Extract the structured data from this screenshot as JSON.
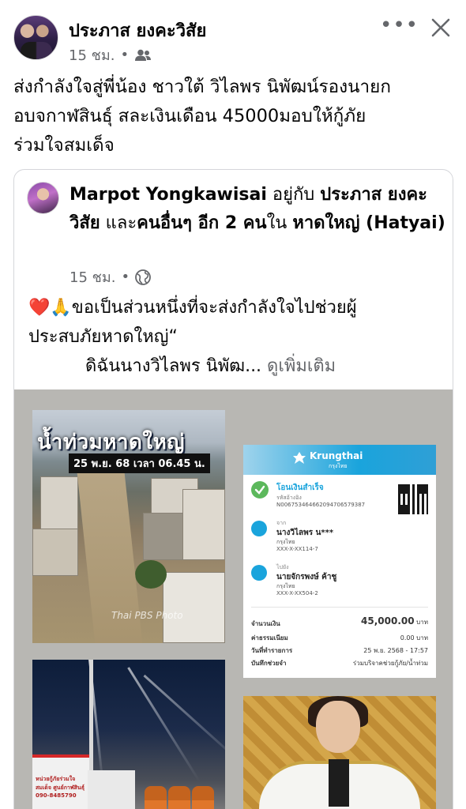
{
  "header": {
    "author": "ประภาส ยงคะวิสัย",
    "time": "15 ชม.",
    "separator": "•",
    "audience_icon": "friends-icon",
    "more_label": "•••",
    "close_icon": "close-icon"
  },
  "post": {
    "text_line1": "ส่งกำลังใจสู่พี่น้อง ชาวใต้ วิไลพร นิพัฒน์รองนายก",
    "text_line2": "อบจกาฬสินธุ์ สละเงินเดือน 45000มอบให้กู้ภัย",
    "text_line3": "ร่วมใจสมเด็จ"
  },
  "shared": {
    "author": "Marpot Yongkawisai",
    "with_word": " อยู่กับ ",
    "tagged": "ประภาส ยงคะวิสัย",
    "and_others_prefix": " และ",
    "others": "คนอื่นๆ อีก 2 คน",
    "in_word": "ใน ",
    "place": "หาดใหญ่ (Hatyai)",
    "time": "15 ชม.",
    "separator": "•",
    "audience_icon": "globe-icon",
    "body_line1_emoji": "❤️🙏",
    "body_line1": "ขอเป็นส่วนหนึ่งที่จะส่งกำลังใจไปช่วยผู้",
    "body_line2": "ประสบภัยหาดใหญ่“",
    "body_line3": "ดิฉันนางวิไลพร  นิพัฒ... ",
    "see_more": "ดูเพิ่มเติม"
  },
  "media": {
    "flood": {
      "title": "น้ำท่วมหาดใหญ่",
      "date": "25 พ.ย. 68 เวลา 06.45 น.",
      "watermark": "Thai PBS Photo"
    },
    "slip": {
      "bank": "Krungthai",
      "bank_th": "กรุงไทย",
      "status": "โอนเงินสำเร็จ",
      "ref_label": "รหัสอ้างอิง",
      "ref": "N006753464662094706579387",
      "from_label": "จาก",
      "from_name": "นางวิไลพร น***",
      "from_bank": "กรุงไทย",
      "from_acct": "XXX-X-XX114-7",
      "to_label": "ไปยัง",
      "to_name": "นายจักรพงษ์ ค้าชู",
      "to_bank": "กรุงไทย",
      "to_acct": "XXX-X-XX504-2",
      "amount_label": "จำนวนเงิน",
      "amount": "45,000.00",
      "currency": "บาท",
      "fee_label": "ค่าธรรมเนียม",
      "fee": "0.00 บาท",
      "date_label": "วันที่ทำรายการ",
      "date": "25 พ.ย. 2568 - 17:57",
      "memo_label": "บันทึกช่วยจำ",
      "memo": "ร่วมบริจาคช่วยกู้ภัย/น้ำท่วม"
    },
    "night": {
      "truck_text": "หน่วยกู้ภัยร่วมใจสมเด็จ ศูนย์กาฬสินธุ์ 090-8485790"
    }
  },
  "colors": {
    "text": "#050505",
    "secondary": "#65676b",
    "border": "#d5d6da",
    "krungthai": "#1aa4dc"
  }
}
